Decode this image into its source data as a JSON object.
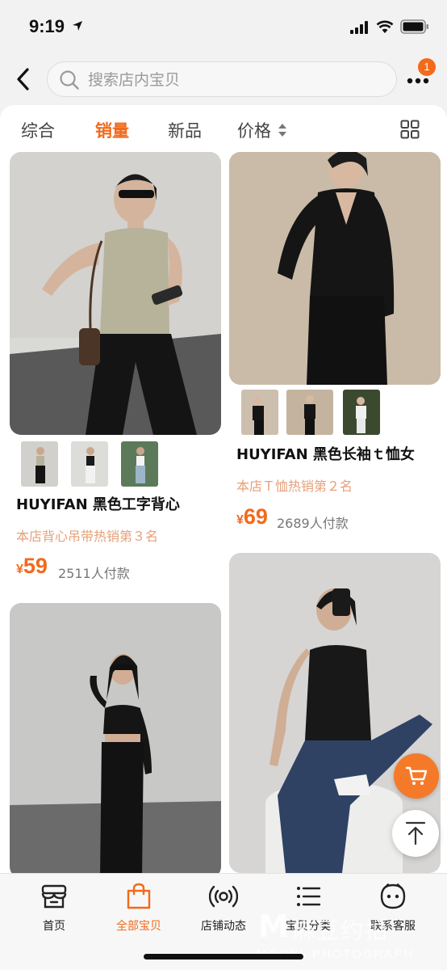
{
  "status_bar": {
    "time": "9:19"
  },
  "search": {
    "placeholder": "搜索店内宝贝"
  },
  "more": {
    "badge_count": "1"
  },
  "sort_tabs": [
    {
      "label": "综合",
      "active": false
    },
    {
      "label": "销量",
      "active": true
    },
    {
      "label": "新品",
      "active": false
    },
    {
      "label": "价格",
      "active": false
    }
  ],
  "products": [
    {
      "title": "HUYIFAN 黑色工字背心",
      "rank": "本店背心吊带热销第３名",
      "currency": "¥",
      "price": "59",
      "sold": "2511人付款"
    },
    {
      "title": "HUYIFAN 黑色长袖ｔ恤女",
      "rank": "本店Ｔ恤热销第２名",
      "currency": "¥",
      "price": "69",
      "sold": "2689人付款"
    }
  ],
  "tab_bar": [
    {
      "label": "首页",
      "icon": "shop-icon",
      "active": false
    },
    {
      "label": "全部宝贝",
      "icon": "bag-icon",
      "active": true
    },
    {
      "label": "店铺动态",
      "icon": "broadcast-icon",
      "active": false
    },
    {
      "label": "宝贝分类",
      "icon": "list-icon",
      "active": false
    },
    {
      "label": "联系客服",
      "icon": "service-face-icon",
      "active": false
    }
  ],
  "watermark": {
    "cn": "麻豆约拍",
    "en": "MODEL PHOTOGRAPH"
  },
  "colors": {
    "accent": "#f26a1b",
    "rank_text": "#e6a07a",
    "background": "#f2f2f2"
  }
}
